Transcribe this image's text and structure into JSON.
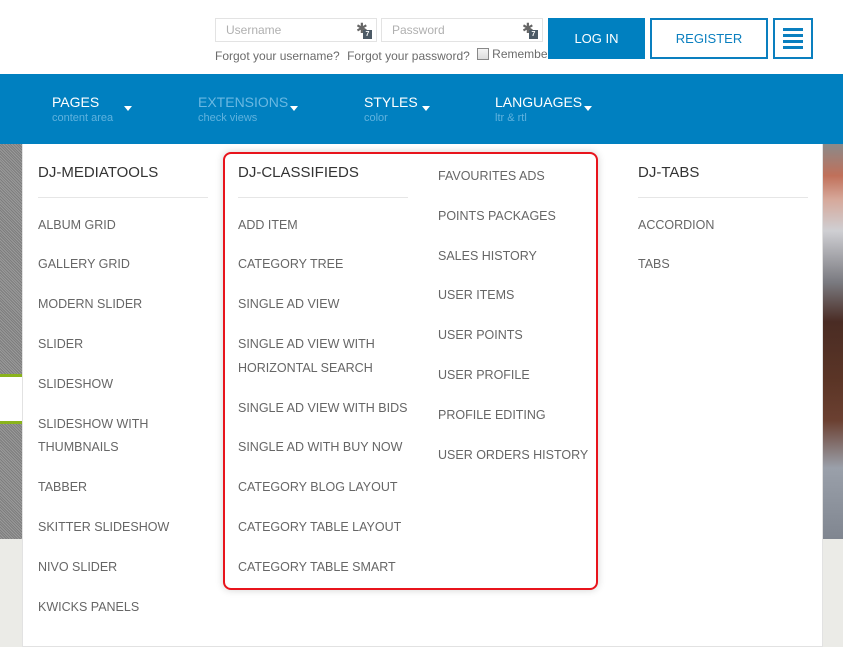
{
  "login": {
    "username_placeholder": "Username",
    "password_placeholder": "Password",
    "forgot_username": "Forgot your username?",
    "forgot_password": "Forgot your password?",
    "remember_me": "Remember Me",
    "remember_checked": false,
    "key_badge": "7",
    "login_button": "LOG IN",
    "register_button": "REGISTER"
  },
  "colors": {
    "primary": "#0080c0",
    "highlight_border": "#e8141c",
    "accent_green": "#8ab31c"
  },
  "nav": {
    "items": [
      {
        "title": "PAGES",
        "subtitle": "content area",
        "active": false
      },
      {
        "title": "EXTENSIONS",
        "subtitle": "check views",
        "active": true
      },
      {
        "title": "STYLES",
        "subtitle": "color",
        "active": false
      },
      {
        "title": "LANGUAGES",
        "subtitle": "ltr & rtl",
        "active": false
      }
    ]
  },
  "mega_menu": {
    "columns": [
      {
        "title": "DJ-MEDIATOOLS",
        "items": [
          "ALBUM GRID",
          "GALLERY GRID",
          "MODERN SLIDER",
          "SLIDER",
          "SLIDESHOW",
          "SLIDESHOW WITH",
          "THUMBNAILS",
          "TABBER",
          "SKITTER SLIDESHOW",
          "NIVO SLIDER",
          "KWICKS PANELS"
        ]
      },
      {
        "title": "DJ-CLASSIFIEDS",
        "items": [
          "ADD ITEM",
          "CATEGORY TREE",
          "SINGLE AD VIEW",
          "SINGLE AD VIEW WITH",
          "HORIZONTAL SEARCH",
          "SINGLE AD VIEW WITH BIDS",
          "SINGLE AD WITH BUY NOW",
          "CATEGORY BLOG LAYOUT",
          "CATEGORY TABLE LAYOUT",
          "CATEGORY TABLE SMART"
        ],
        "items_col2": [
          "FAVOURITES ADS",
          "POINTS PACKAGES",
          "SALES HISTORY",
          "USER ITEMS",
          "USER POINTS",
          "USER PROFILE",
          "PROFILE EDITING",
          "USER ORDERS HISTORY"
        ]
      },
      {
        "title": "DJ-TABS",
        "items": [
          "ACCORDION",
          "TABS"
        ]
      }
    ]
  }
}
